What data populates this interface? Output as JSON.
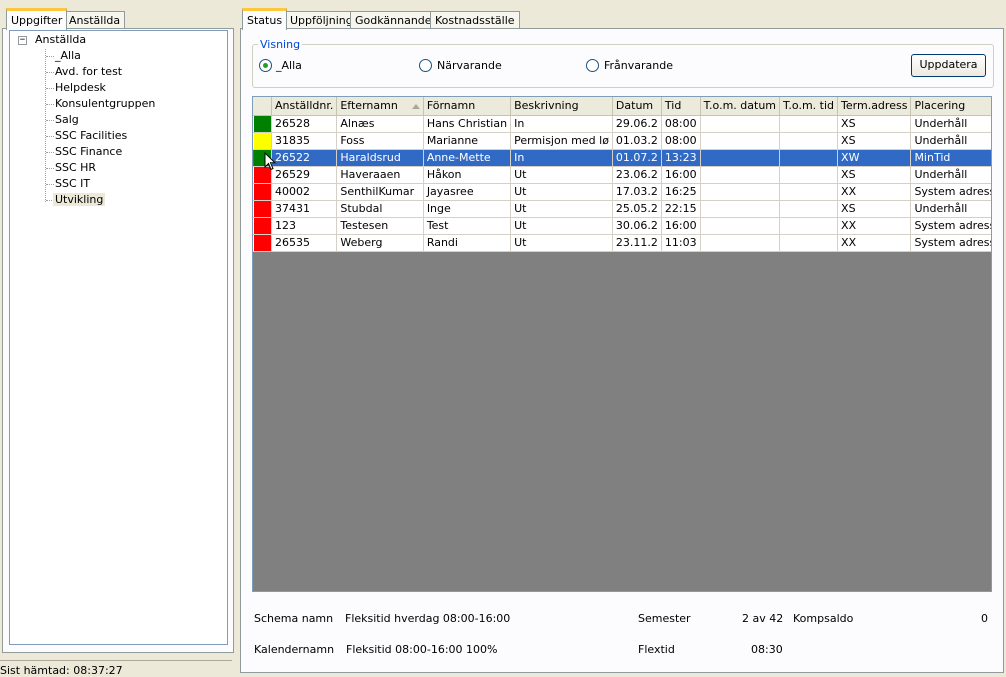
{
  "left_tabs": [
    "Uppgifter",
    "Anställda"
  ],
  "tree": {
    "root": "Anställda",
    "toggle": "−",
    "children": [
      "_Alla",
      "Avd. for test",
      "Helpdesk",
      "Konsulentgruppen",
      "Salg",
      "SSC Facilities",
      "SSC Finance",
      "SSC HR",
      "SSC IT",
      "Utvikling"
    ],
    "selected": "Utvikling"
  },
  "status_bar": "Sist hämtad: 08:37:27",
  "right_tabs": [
    "Status",
    "Uppföljning",
    "Godkännande",
    "Kostnadsställe"
  ],
  "visning": {
    "legend": "Visning",
    "options": [
      "_Alla",
      "Närvarande",
      "Frånvarande"
    ],
    "selected": "_Alla",
    "button": "Uppdatera"
  },
  "grid": {
    "columns": [
      "Anställdnr.",
      "Efternamn",
      "Förnamn",
      "Beskrivning",
      "Datum",
      "Tid",
      "T.o.m. datum",
      "T.o.m. tid",
      "Term.adress",
      "Placering"
    ],
    "sorted_column": "Efternamn",
    "rows": [
      {
        "status_color": "#008000",
        "cells": [
          "26528",
          "Alnæs",
          "Hans Christian",
          "In",
          "29.06.2",
          "08:00",
          "",
          "",
          "XS",
          "Underhåll"
        ]
      },
      {
        "status_color": "#ffff00",
        "cells": [
          "31835",
          "Foss",
          "Marianne",
          "Permisjon med lø",
          "01.03.2",
          "08:00",
          "",
          "",
          "XS",
          "Underhåll"
        ]
      },
      {
        "status_color": "#008000",
        "selected": true,
        "cells": [
          "26522",
          "Haraldsrud",
          "Anne-Mette",
          "In",
          "01.07.2",
          "13:23",
          "",
          "",
          "XW",
          "MinTid"
        ]
      },
      {
        "status_color": "#ff0000",
        "cells": [
          "26529",
          "Haveraaen",
          "Håkon",
          "Ut",
          "23.06.2",
          "16:00",
          "",
          "",
          "XS",
          "Underhåll"
        ]
      },
      {
        "status_color": "#ff0000",
        "cells": [
          "40002",
          "SenthilKumar",
          "Jayasree",
          "Ut",
          "17.03.2",
          "16:25",
          "",
          "",
          "XX",
          "System adresse"
        ]
      },
      {
        "status_color": "#ff0000",
        "cells": [
          "37431",
          "Stubdal",
          "Inge",
          "Ut",
          "25.05.2",
          "22:15",
          "",
          "",
          "XS",
          "Underhåll"
        ]
      },
      {
        "status_color": "#ff0000",
        "cells": [
          "123",
          "Testesen",
          "Test",
          "Ut",
          "30.06.2",
          "16:00",
          "",
          "",
          "XX",
          "System adresse"
        ]
      },
      {
        "status_color": "#ff0000",
        "cells": [
          "26535",
          "Weberg",
          "Randi",
          "Ut",
          "23.11.2",
          "11:03",
          "",
          "",
          "XX",
          "System adresse"
        ]
      }
    ]
  },
  "info": {
    "schema_label": "Schema namn",
    "schema_value": "Fleksitid hverdag 08:00-16:00",
    "kalender_label": "Kalendernamn",
    "kalender_value": "Fleksitid 08:00-16:00 100%",
    "semester_label": "Semester",
    "semester_value": "2 av 42",
    "kompsaldo_label": "Kompsaldo",
    "kompsaldo_value": "0",
    "flextid_label": "Flextid",
    "flextid_value": "08:30"
  },
  "icons": {
    "cursor": "mouse-pointer-icon"
  }
}
